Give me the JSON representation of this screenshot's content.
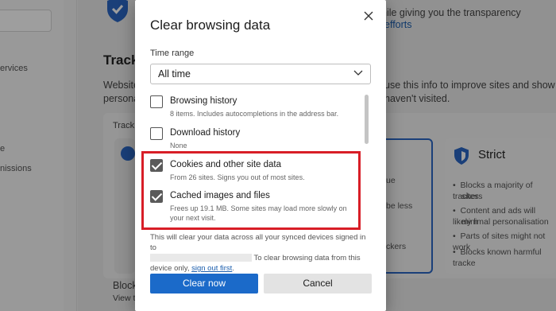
{
  "background": {
    "sidebar_items": [
      "ervices",
      "e",
      "nissions"
    ],
    "partial_heading": "Tracki",
    "intro_line1_left": "Website",
    "intro_line2_left": "persona",
    "intro_line1_right": "use this info to improve sites and show you",
    "intro_line2_right": "haven't visited.",
    "top_right_text": "hile giving you the transparency",
    "top_right_link": "efforts",
    "card_label": "Track",
    "strict_title": "Strict",
    "strict_items": [
      "Blocks a majority of trackers",
      "sites",
      "Content and ads will likely h",
      "minimal personalisation",
      "Parts of sites might not work",
      "Blocks known harmful tracke"
    ],
    "mid_items": [
      "ue",
      "be less",
      "ckers"
    ],
    "bottom_block": "Block",
    "bottom_view": "View t"
  },
  "dialog": {
    "title": "Clear browsing data",
    "close_icon": "close-icon",
    "time_range_label": "Time range",
    "time_range_value": "All time",
    "options": [
      {
        "title": "Browsing history",
        "desc": "8 items. Includes autocompletions in the address bar.",
        "checked": false
      },
      {
        "title": "Download history",
        "desc": "None",
        "checked": false
      },
      {
        "title": "Cookies and other site data",
        "desc": "From 26 sites. Signs you out of most sites.",
        "checked": true
      },
      {
        "title": "Cached images and files",
        "desc": "Frees up 19.1 MB. Some sites may load more slowly on your next visit.",
        "checked": true
      }
    ],
    "sync_note_part1": "This will clear your data across all your synced devices signed in to",
    "sync_note_part2": "To clear browsing data from this",
    "sync_note_part3": "device only,",
    "sign_out_link": "sign out first",
    "clear_button": "Clear now",
    "cancel_button": "Cancel",
    "highlight_color": "#d81e27",
    "primary_color": "#1b6ac9"
  }
}
